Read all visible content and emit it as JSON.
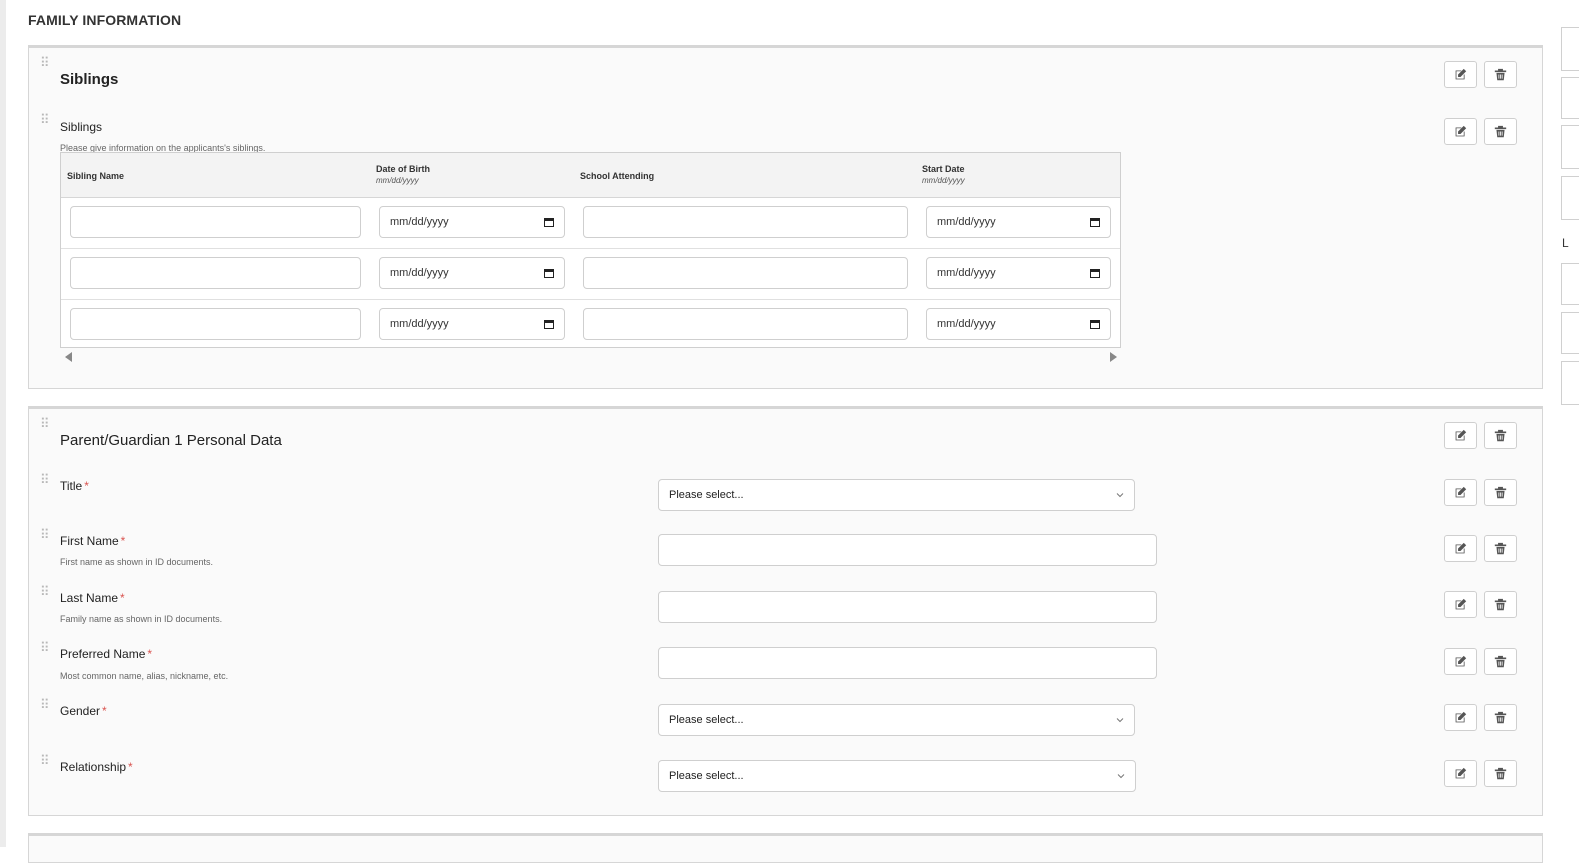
{
  "page": {
    "title": "FAMILY INFORMATION"
  },
  "siblings_section": {
    "heading": "Siblings",
    "field_label": "Siblings",
    "field_help": "Please give information on the applicants's siblings.",
    "columns": [
      {
        "label": "Sibling Name",
        "format": ""
      },
      {
        "label": "Date of Birth",
        "format": "mm/dd/yyyy"
      },
      {
        "label": "School Attending",
        "format": ""
      },
      {
        "label": "Start Date",
        "format": "mm/dd/yyyy"
      }
    ],
    "date_placeholder": "mm/dd/yyyy",
    "rows": [
      {
        "name": "",
        "dob": "mm/dd/yyyy",
        "school": "",
        "start": "mm/dd/yyyy"
      },
      {
        "name": "",
        "dob": "mm/dd/yyyy",
        "school": "",
        "start": "mm/dd/yyyy"
      },
      {
        "name": "",
        "dob": "mm/dd/yyyy",
        "school": "",
        "start": "mm/dd/yyyy"
      }
    ]
  },
  "parent_section": {
    "heading": "Parent/Guardian 1 Personal Data",
    "fields": {
      "title": {
        "label": "Title",
        "required": "*",
        "value": "Please select..."
      },
      "first_name": {
        "label": "First Name",
        "required": "*",
        "help": "First name as shown in ID documents."
      },
      "last_name": {
        "label": "Last Name",
        "required": "*",
        "help": "Family name as shown in ID documents."
      },
      "preferred_name": {
        "label": "Preferred Name",
        "required": "*",
        "help": "Most common name, alias, nickname, etc."
      },
      "gender": {
        "label": "Gender",
        "required": "*",
        "value": "Please select..."
      },
      "relationship": {
        "label": "Relationship",
        "required": "*",
        "value": "Please select..."
      }
    }
  },
  "right_panel": {
    "letter": "L"
  },
  "icons": {
    "edit": "edit-icon",
    "delete": "trash-icon",
    "drag": "drag-handle-icon"
  }
}
